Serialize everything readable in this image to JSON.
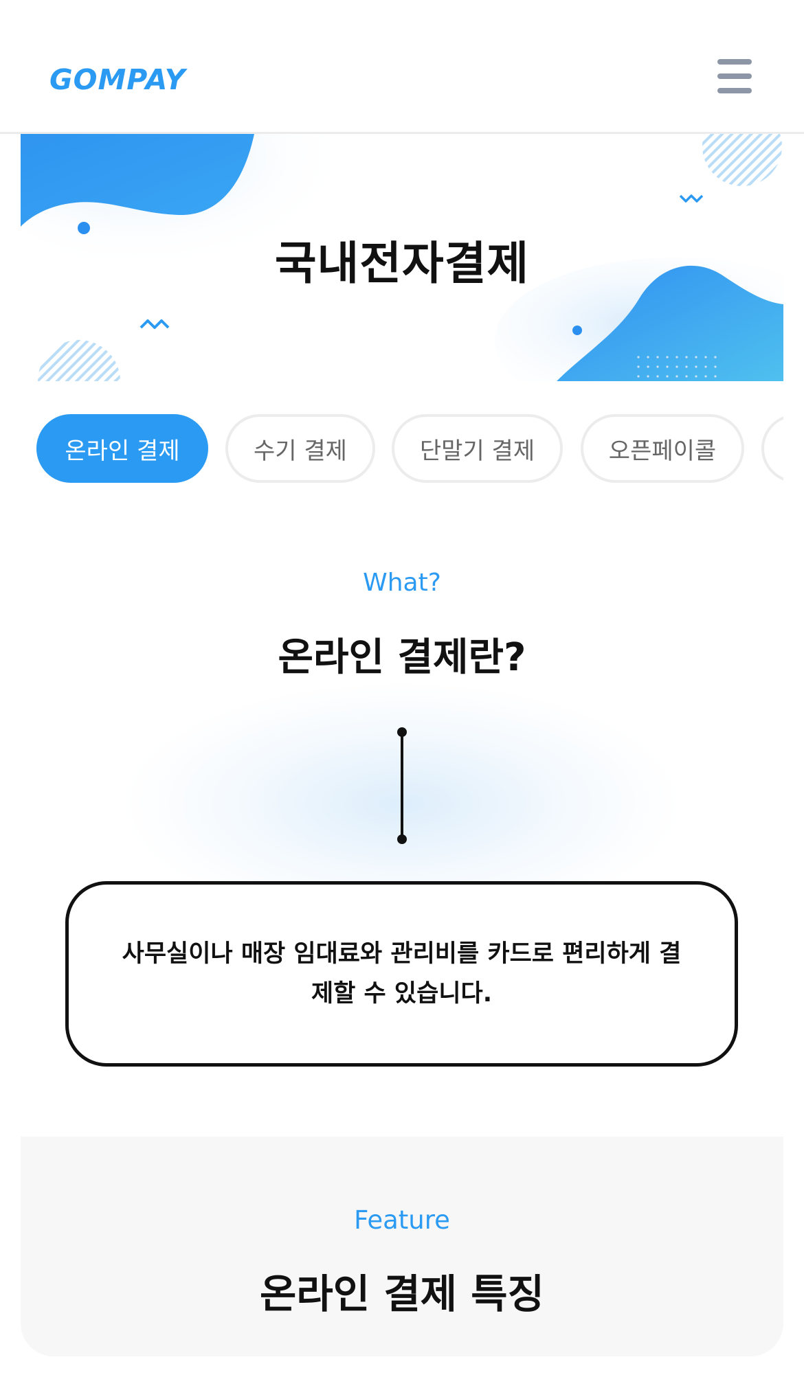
{
  "header": {
    "logo_text": "GOMPAY",
    "menu_icon": "hamburger-menu-icon"
  },
  "hero": {
    "title": "국내전자결제"
  },
  "tabs": [
    {
      "label": "온라인 결제",
      "active": true
    },
    {
      "label": "수기 결제",
      "active": false
    },
    {
      "label": "단말기 결제",
      "active": false
    },
    {
      "label": "오픈페이콜",
      "active": false
    },
    {
      "label": "",
      "active": false
    }
  ],
  "what": {
    "label": "What?",
    "title": "온라인 결제란?",
    "description": "사무실이나 매장 임대료와 관리비를 카드로 편리하게 결제할 수 있습니다."
  },
  "feature": {
    "label": "Feature",
    "title": "온라인 결제 특징"
  },
  "colors": {
    "accent": "#2b9af3",
    "hero_blue": "#2f95f0",
    "tab_border": "#ececec",
    "menu_icon": "#8c96a6",
    "feature_bg": "#f7f7f7"
  }
}
